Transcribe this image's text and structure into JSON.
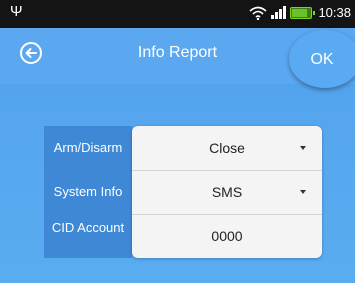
{
  "status_bar": {
    "usb_icon": "usb-icon",
    "wifi_icon": "wifi-icon",
    "signal_icon": "signal-icon",
    "battery_icon": "battery-icon",
    "battery_level": 0.8,
    "time": "10:38"
  },
  "header": {
    "title": "Info Report",
    "back_icon": "back-arrow-icon",
    "ok_label": "OK"
  },
  "form": {
    "rows": [
      {
        "label": "Arm/Disarm",
        "value": "Close",
        "has_dropdown": true
      },
      {
        "label": "System Info",
        "value": "SMS",
        "has_dropdown": true
      },
      {
        "label": "CID Account",
        "value": "0000",
        "has_dropdown": false
      }
    ]
  },
  "colors": {
    "background": "#55a6ee",
    "title_bar": "#5ba7f0",
    "label_column": "#3f88d6",
    "value_box": "#f4f4f4",
    "status_bar": "#141414"
  }
}
